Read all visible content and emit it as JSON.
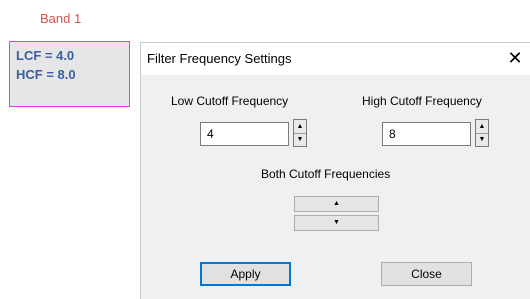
{
  "band": {
    "title": "Band 1",
    "lcf_text": "LCF = 4.0",
    "hcf_text": "HCF = 8.0"
  },
  "dialog": {
    "title": "Filter Frequency Settings",
    "close_glyph": "✕",
    "low_label": "Low Cutoff Frequency",
    "high_label": "High Cutoff Frequency",
    "low_value": "4",
    "high_value": "8",
    "both_label": "Both Cutoff Frequencies",
    "apply_label": "Apply",
    "close_label": "Close"
  },
  "glyphs": {
    "up": "▲",
    "down": "▼"
  },
  "colors": {
    "band_title": "#d9534f",
    "band_border": "#e040e0",
    "band_text": "#3a5fa0",
    "focus_border": "#0078d7"
  }
}
